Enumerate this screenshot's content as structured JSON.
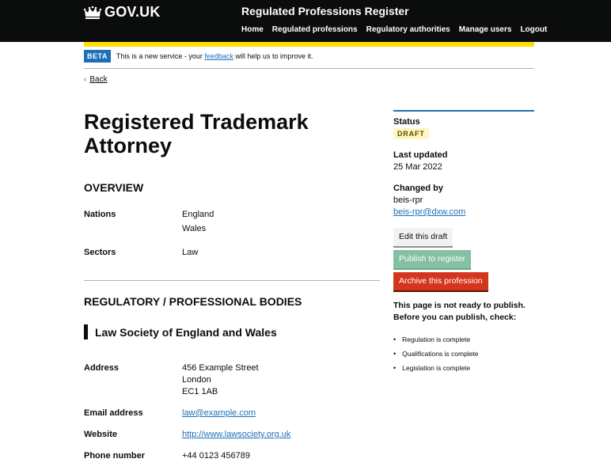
{
  "header": {
    "logo_text": "GOV.UK",
    "service_name": "Regulated Professions Register",
    "nav": [
      "Home",
      "Regulated professions",
      "Regulatory authorities",
      "Manage users",
      "Logout"
    ]
  },
  "phase_banner": {
    "tag": "BETA",
    "text_before": "This is a new service - your ",
    "link": "feedback",
    "text_after": " will help us to improve it."
  },
  "back_link": "Back",
  "profession": {
    "title": "Registered Trademark Attorney",
    "overview_heading": "OVERVIEW",
    "nations_label": "Nations",
    "nations": [
      "England",
      "Wales"
    ],
    "sectors_label": "Sectors",
    "sectors": [
      "Law"
    ]
  },
  "bodies": {
    "heading": "REGULATORY / PROFESSIONAL BODIES",
    "name": "Law Society of England and Wales",
    "address_label": "Address",
    "address": [
      "456 Example Street",
      "London",
      "EC1 1AB"
    ],
    "email_label": "Email address",
    "email": "law@example.com",
    "website_label": "Website",
    "website": "http://www.lawsociety.org.uk",
    "phone_label": "Phone number",
    "phone": "+44 0123 456789"
  },
  "sidebar": {
    "status_label": "Status",
    "status_tag": "DRAFT",
    "last_updated_label": "Last updated",
    "last_updated": "25 Mar 2022",
    "changed_by_label": "Changed by",
    "changed_by_user": "beis-rpr",
    "changed_by_email": "beis-rpr@dxw.com",
    "edit_button": "Edit this draft",
    "publish_button": "Publish to register",
    "archive_button": "Archive this profession",
    "not_ready_text": "This page is not ready to publish. Before you can publish, check:",
    "checklist": [
      "Regulation is complete",
      "Qualifications is complete",
      "Legislation is complete"
    ]
  },
  "colors": {
    "header_bg": "#0b0c0c",
    "yellow_bar": "#ffdd00",
    "link": "#1d70b8",
    "archive_red": "#d4351c",
    "publish_green": "#85c0a3",
    "draft_tag_bg": "#fff7bf"
  }
}
